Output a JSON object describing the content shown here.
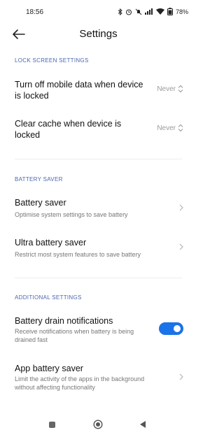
{
  "status_bar": {
    "time": "18:56",
    "battery_percent": "78",
    "icons": [
      "bluetooth-icon",
      "alarm-icon",
      "mute-icon",
      "signal-icon",
      "wifi-icon",
      "battery-icon"
    ]
  },
  "header": {
    "title": "Settings"
  },
  "sections": {
    "lock_screen": {
      "label": "LOCK SCREEN SETTINGS",
      "items": [
        {
          "title_line1": "Turn off mobile data when device",
          "title_line2": "is locked",
          "value": "Never"
        },
        {
          "title_line1": "Clear cache when device is",
          "title_line2": "locked",
          "value": "Never"
        }
      ]
    },
    "battery_saver": {
      "label": "BATTERY SAVER",
      "items": [
        {
          "title": "Battery saver",
          "subtitle": "Optimise system settings to save battery"
        },
        {
          "title": "Ultra battery saver",
          "subtitle": "Restrict most system features to save battery"
        }
      ]
    },
    "additional": {
      "label": "ADDITIONAL SETTINGS",
      "items": [
        {
          "title": "Battery drain notifications",
          "subtitle_line1": "Receive notifications when battery is being",
          "subtitle_line2": "drained fast",
          "enabled": true
        },
        {
          "title": "App battery saver",
          "subtitle_line1": "Limit the activity of the apps in the background",
          "subtitle_line2": "without affecting functionality"
        }
      ]
    }
  },
  "colors": {
    "accent": "#1a73e8",
    "section_label": "#4a66b0"
  }
}
